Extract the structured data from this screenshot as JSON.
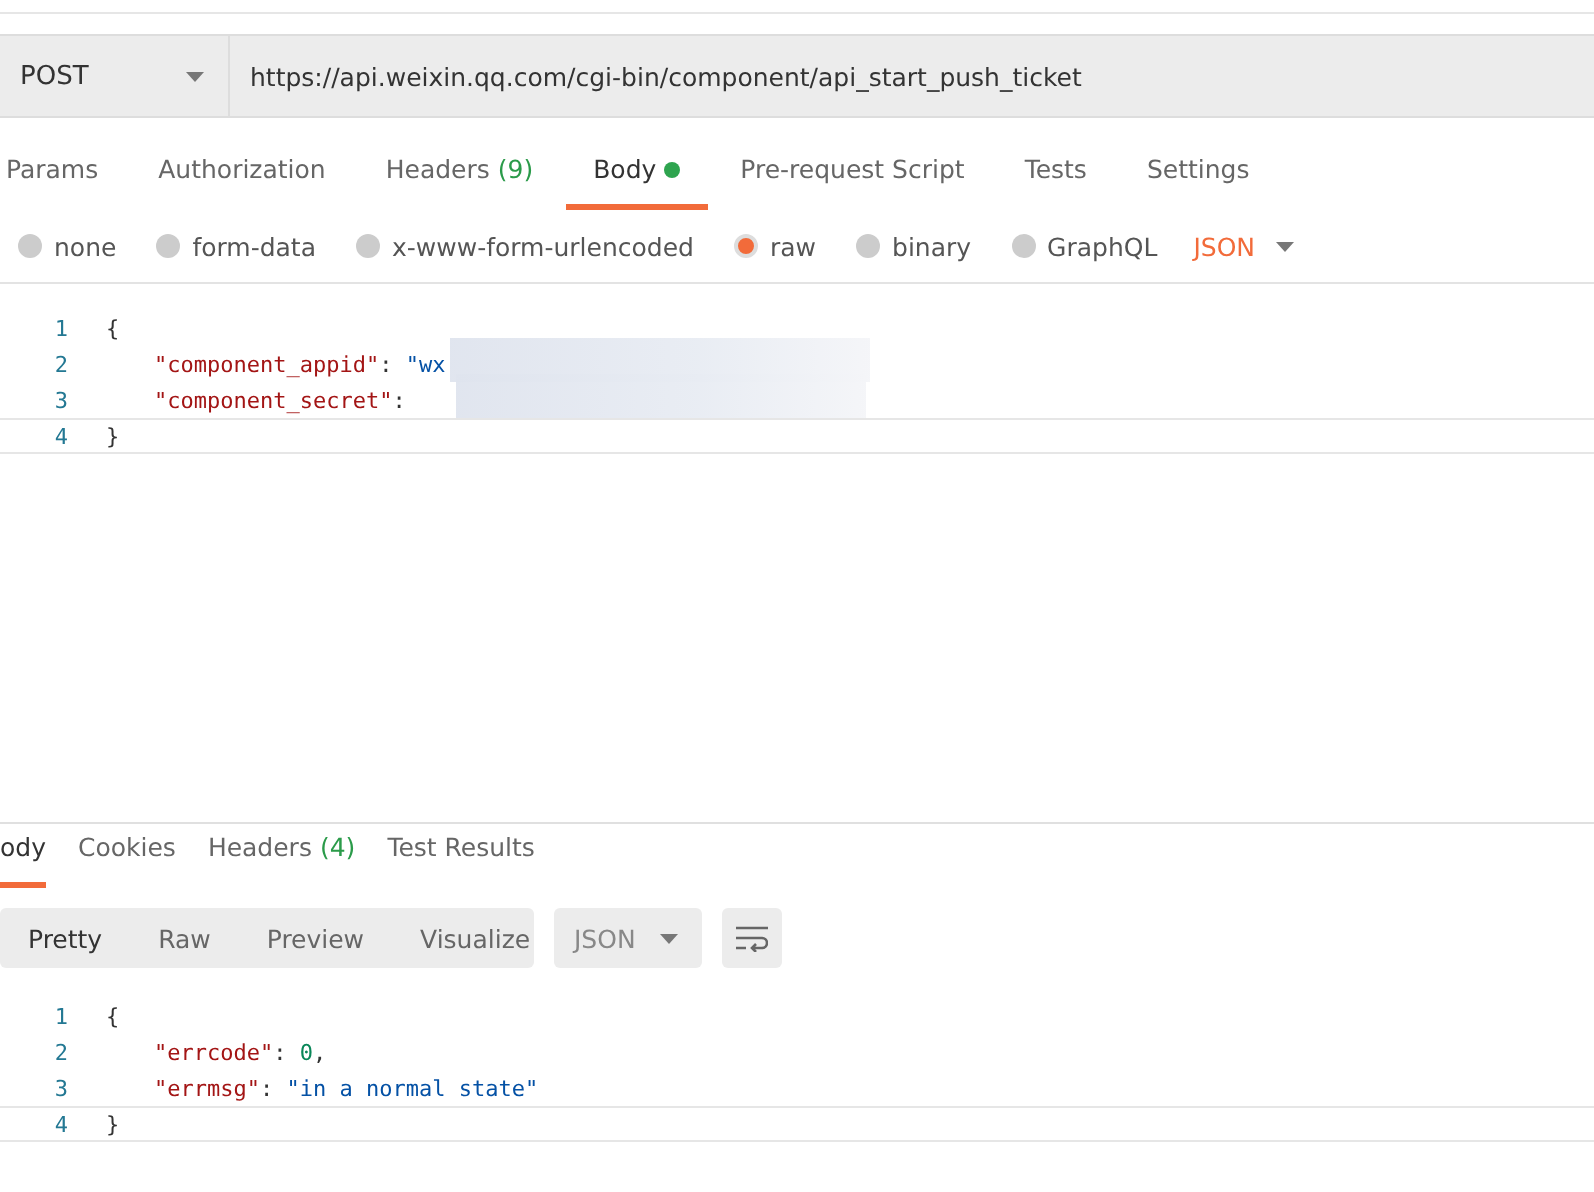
{
  "request": {
    "method": "POST",
    "url": "https://api.weixin.qq.com/cgi-bin/component/api_start_push_ticket"
  },
  "request_tabs": [
    {
      "label": "Params",
      "selected": false
    },
    {
      "label": "Authorization",
      "selected": false
    },
    {
      "label": "Headers",
      "count": "(9)",
      "selected": false
    },
    {
      "label": "Body",
      "dot": true,
      "selected": true
    },
    {
      "label": "Pre-request Script",
      "selected": false
    },
    {
      "label": "Tests",
      "selected": false
    },
    {
      "label": "Settings",
      "selected": false
    }
  ],
  "body_types": [
    {
      "label": "none",
      "selected": false
    },
    {
      "label": "form-data",
      "selected": false
    },
    {
      "label": "x-www-form-urlencoded",
      "selected": false
    },
    {
      "label": "raw",
      "selected": true
    },
    {
      "label": "binary",
      "selected": false
    },
    {
      "label": "GraphQL",
      "selected": false
    }
  ],
  "body_format": "JSON",
  "request_editor": {
    "lines": [
      {
        "number": "1",
        "active": false,
        "redacted": false,
        "tokens": [
          {
            "kind": "punct",
            "text": "{"
          }
        ]
      },
      {
        "number": "2",
        "active": false,
        "redacted": true,
        "tokens": [
          {
            "kind": "key",
            "text": "\"component_appid\""
          },
          {
            "kind": "punct",
            "text": ": "
          },
          {
            "kind": "string",
            "text": "\"wx"
          }
        ]
      },
      {
        "number": "3",
        "active": false,
        "redacted": true,
        "tokens": [
          {
            "kind": "key",
            "text": "\"component_secret\""
          },
          {
            "kind": "punct",
            "text": ": "
          }
        ]
      },
      {
        "number": "4",
        "active": true,
        "redacted": false,
        "tokens": [
          {
            "kind": "punct",
            "text": "}"
          }
        ]
      }
    ]
  },
  "response_tabs": [
    {
      "label": "ody",
      "selected": true
    },
    {
      "label": "Cookies",
      "selected": false
    },
    {
      "label": "Headers",
      "count": "(4)",
      "selected": false
    },
    {
      "label": "Test Results",
      "selected": false
    }
  ],
  "view_modes": [
    {
      "label": "Pretty",
      "selected": true
    },
    {
      "label": "Raw",
      "selected": false
    },
    {
      "label": "Preview",
      "selected": false
    },
    {
      "label": "Visualize",
      "selected": false
    }
  ],
  "response_format": "JSON",
  "response_editor": {
    "lines": [
      {
        "number": "1",
        "active": false,
        "redacted": false,
        "tokens": [
          {
            "kind": "punct",
            "text": "{"
          }
        ]
      },
      {
        "number": "2",
        "active": false,
        "redacted": false,
        "tokens": [
          {
            "kind": "key",
            "text": "\"errcode\""
          },
          {
            "kind": "punct",
            "text": ": "
          },
          {
            "kind": "number",
            "text": "0"
          },
          {
            "kind": "punct",
            "text": ","
          }
        ]
      },
      {
        "number": "3",
        "active": false,
        "redacted": false,
        "tokens": [
          {
            "kind": "key",
            "text": "\"errmsg\""
          },
          {
            "kind": "punct",
            "text": ": "
          },
          {
            "kind": "string",
            "text": "\"in a normal state\""
          }
        ]
      },
      {
        "number": "4",
        "active": true,
        "redacted": false,
        "tokens": [
          {
            "kind": "punct",
            "text": "}"
          }
        ]
      }
    ]
  }
}
